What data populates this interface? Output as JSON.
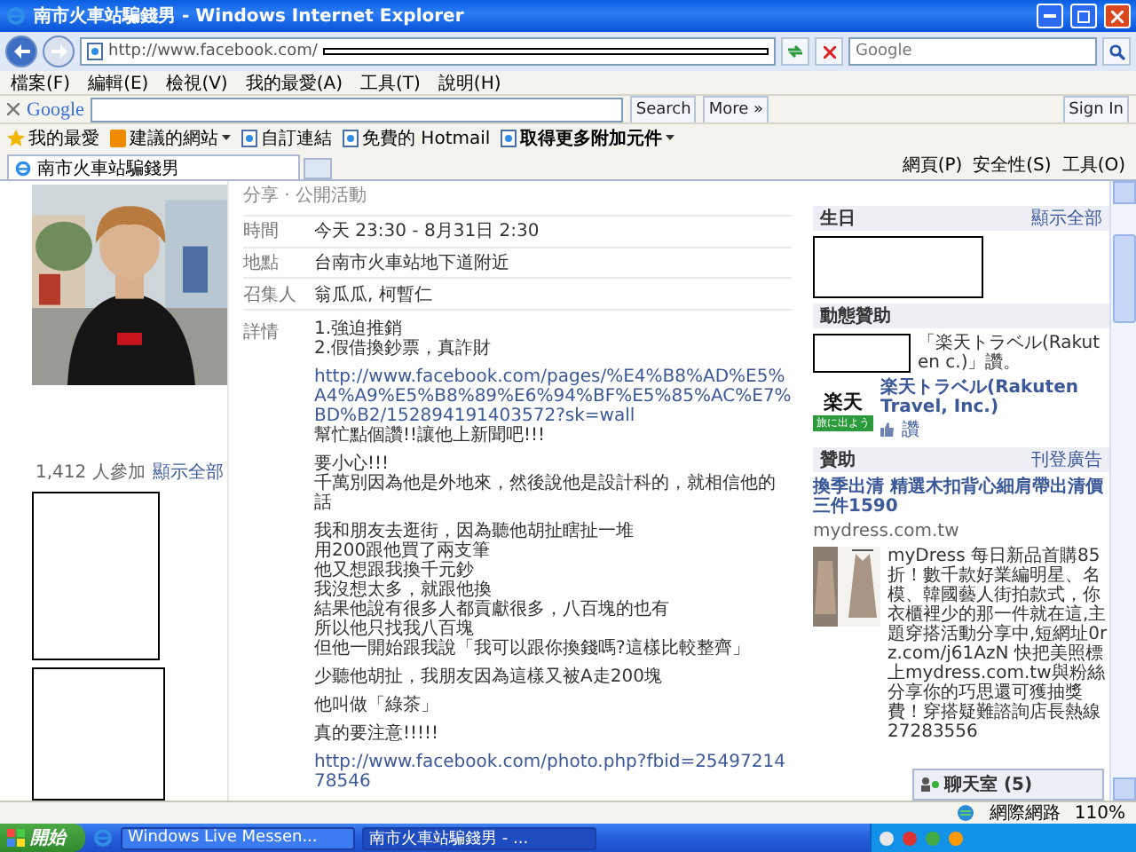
{
  "window": {
    "title": "南市火車站騙錢男 - Windows Internet Explorer"
  },
  "address_bar": {
    "url": "http://www.facebook.com/"
  },
  "search_field": {
    "placeholder": "Google"
  },
  "menu": [
    "檔案(F)",
    "編輯(E)",
    "檢視(V)",
    "我的最愛(A)",
    "工具(T)",
    "說明(H)"
  ],
  "google_toolbar": {
    "logo": "Google",
    "search_button": "Search",
    "more": "More »",
    "sign_in": "Sign In"
  },
  "favorites_bar": {
    "favorites": "我的最愛",
    "links": [
      {
        "label": "建議的網站",
        "kind": "suggested"
      },
      {
        "label": "自訂連結",
        "kind": "link"
      },
      {
        "label": "免費的 Hotmail",
        "kind": "link"
      },
      {
        "label": "取得更多附加元件",
        "kind": "addons"
      }
    ]
  },
  "tabs": [
    {
      "label": "南市火車站騙錢男",
      "selected": true
    }
  ],
  "command_bar": [
    "網頁(P)",
    "安全性(S)",
    "工具(O)"
  ],
  "event": {
    "header": "分享 · 公開活動",
    "attendees": {
      "count": "1,412 人參加",
      "see_all": "顯示全部"
    },
    "rows": [
      {
        "label": "時間",
        "value": "今天 23:30 - 8月31日 2:30"
      },
      {
        "label": "地點",
        "value": "台南市火車站地下道附近"
      },
      {
        "label": "召集人",
        "value": "翁瓜瓜, 柯暫仁"
      }
    ],
    "details": {
      "label": "詳情",
      "paragraphs": [
        [
          {
            "kind": "text",
            "text": "1.強迫推銷"
          },
          {
            "kind": "text",
            "text": "2.假借換鈔票，真詐財"
          }
        ],
        [
          {
            "kind": "link",
            "text": "http://www.facebook.com/pages/%E4%B8%AD%E5%A4%A9%E5%B8%89%E6%94%BF%E5%85%AC%E7%BD%B2/152894191403572?sk=wall"
          },
          {
            "kind": "text",
            "text": "幫忙點個讚!!讓他上新聞吧!!!"
          }
        ],
        [
          {
            "kind": "text",
            "text": "要小心!!!"
          },
          {
            "kind": "text",
            "text": "千萬別因為他是外地來，然後說他是設計科的，就相信他的話"
          }
        ],
        [
          {
            "kind": "text",
            "text": "我和朋友去逛街，因為聽他胡扯瞎扯一堆"
          },
          {
            "kind": "text",
            "text": "用200跟他買了兩支筆"
          },
          {
            "kind": "text",
            "text": "他又想跟我換千元鈔"
          },
          {
            "kind": "text",
            "text": "我沒想太多，就跟他換"
          },
          {
            "kind": "text",
            "text": "結果他說有很多人都貢獻很多，八百塊的也有"
          },
          {
            "kind": "text",
            "text": "所以他只找我八百塊"
          },
          {
            "kind": "text",
            "text": "但他一開始跟我說「我可以跟你換錢嗎?這樣比較整齊」"
          }
        ],
        [
          {
            "kind": "text",
            "text": "少聽他胡扯，我朋友因為這樣又被A走200塊"
          }
        ],
        [
          {
            "kind": "text",
            "text": "他叫做「綠茶」"
          }
        ],
        [
          {
            "kind": "text",
            "text": "真的要注意!!!!!"
          }
        ],
        [
          {
            "kind": "link",
            "text": "http://www.facebook.com/photo.php?fbid=2549721478546"
          }
        ]
      ]
    }
  },
  "sidebar": {
    "birthdays": {
      "title": "生日",
      "see_all": "顯示全部"
    },
    "sponsored_story": {
      "title": "動態贊助",
      "text": "「楽天トラベル(Rakuten c.)」讚。",
      "logo": "楽天",
      "logo_tagline": "旅に出よう",
      "page": "楽天トラベル(Rakuten Travel, Inc.)",
      "like": "讚"
    },
    "ads": {
      "title": "贊助",
      "create": "刊登廣告",
      "headline": "換季出清 精選木扣背心細肩帶出清價三件1590",
      "domain": "mydress.com.tw",
      "body": "myDress 每日新品首購85折！數千款好業編明星、名模、韓國藝人街拍款式，你衣櫃裡少的那一件就在這,主題穿搭活動分享中,短網址0rz.com/j61AzN 快把美照標上mydress.com.tw與粉絲分享你的巧思還可獲抽獎費！穿搭疑難諮詢店長熱線27283556"
    }
  },
  "chat": {
    "label": "聊天室 (5)"
  },
  "status_bar": {
    "zone": "網際網路",
    "zoom": "110%"
  },
  "taskbar": {
    "start": "開始",
    "tasks": [
      {
        "label": "Windows Live Messen...",
        "selected": false
      },
      {
        "label": "南市火車站騙錢男 - ...",
        "selected": true
      }
    ]
  }
}
